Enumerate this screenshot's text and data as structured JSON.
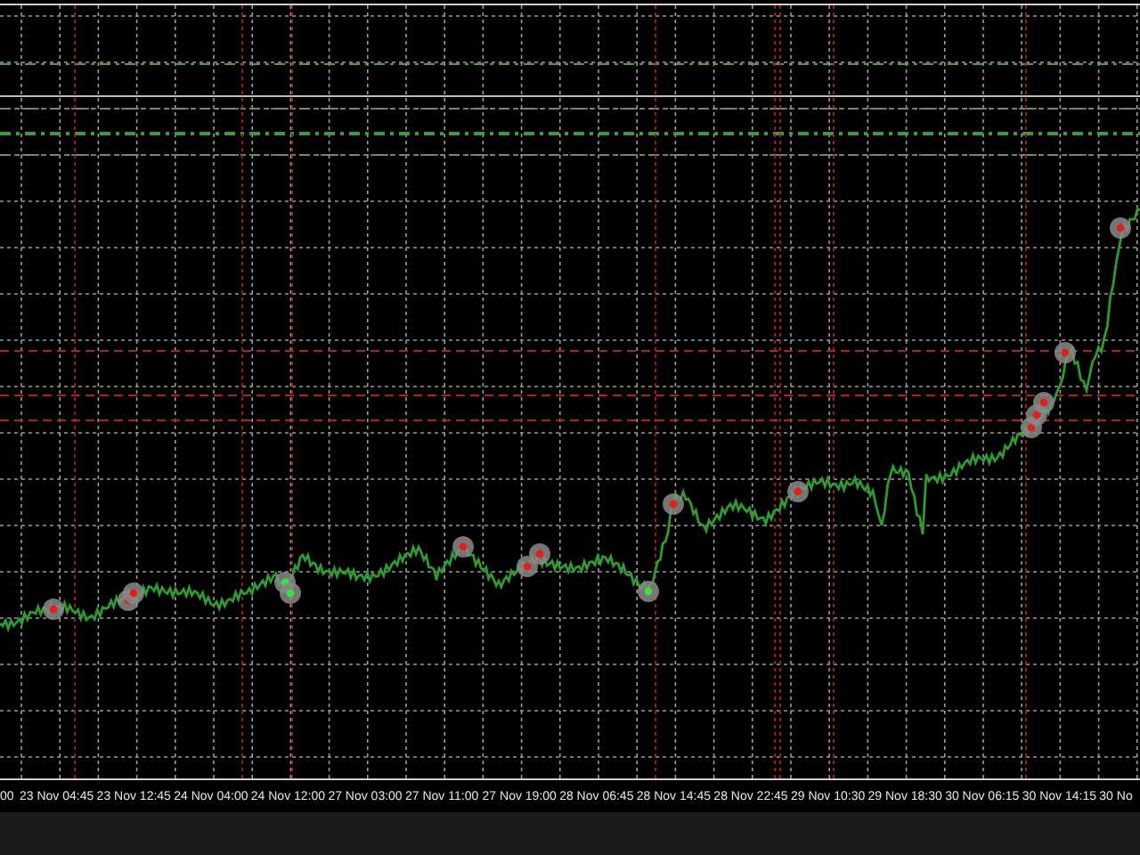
{
  "x_axis": {
    "labels": [
      "00",
      "23 Nov 04:45",
      "23 Nov 12:45",
      "24 Nov 04:00",
      "24 Nov 12:00",
      "27 Nov 03:00",
      "27 Nov 11:00",
      "27 Nov 19:00",
      "28 Nov 06:45",
      "28 Nov 14:45",
      "28 Nov 22:45",
      "29 Nov 10:30",
      "29 Nov 18:30",
      "30 Nov 06:15",
      "30 Nov 14:15",
      "30 No"
    ]
  }
}
